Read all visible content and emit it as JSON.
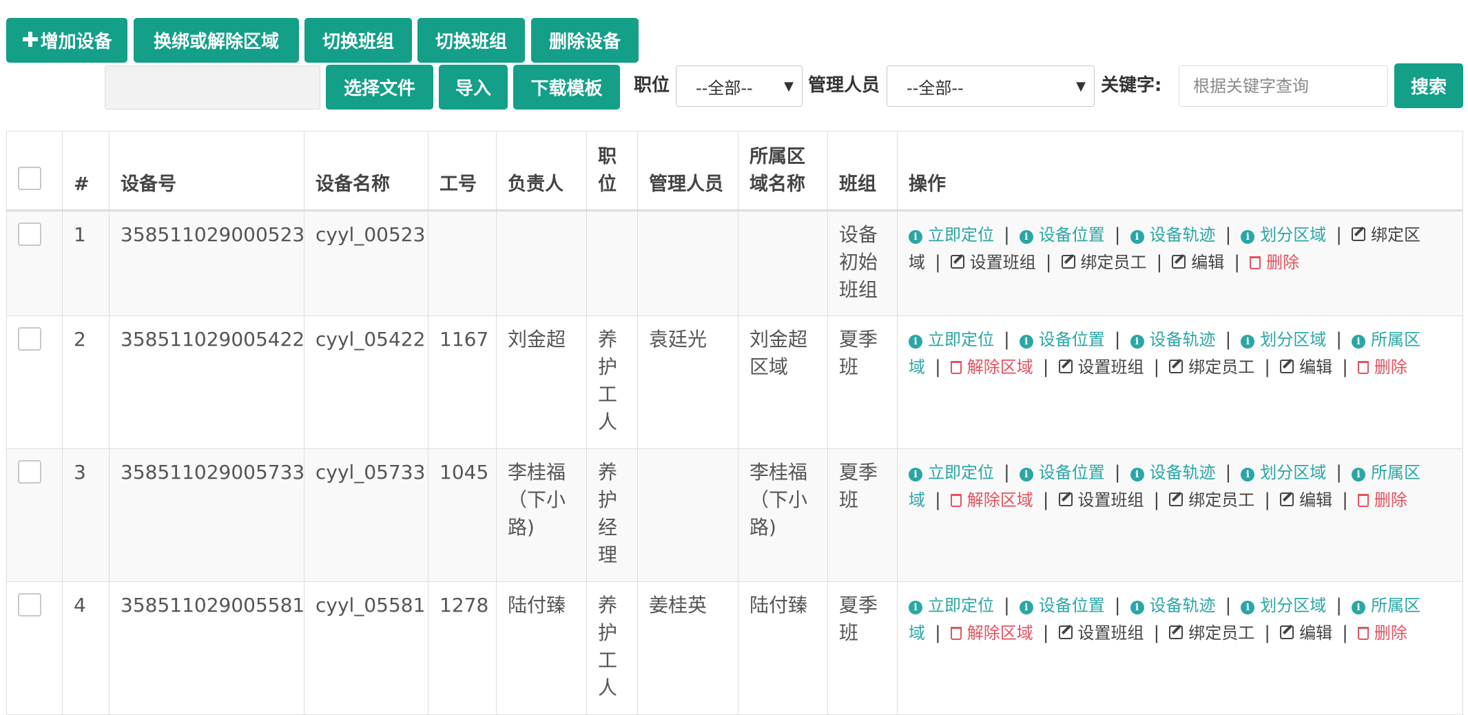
{
  "toolbar": {
    "add_device": "增加设备",
    "rebind_region": "换绑或解除区域",
    "switch_group_1": "切换班组",
    "switch_group_2": "切换班组",
    "delete_device": "删除设备",
    "choose_file": "选择文件",
    "import": "导入",
    "download_template": "下载模板",
    "position_label": "职位",
    "position_value": "--全部--",
    "manager_label": "管理人员",
    "manager_value": "--全部--",
    "keyword_label": "关键字:",
    "keyword_placeholder": "根据关键字查询",
    "search": "搜索"
  },
  "table": {
    "headers": [
      "#",
      "设备号",
      "设备名称",
      "工号",
      "负责人",
      "职位",
      "管理人员",
      "所属区域名称",
      "班组",
      "操作"
    ],
    "rows": [
      {
        "no": "1",
        "device_id": "358511029000523",
        "name": "cyyl_00523",
        "emp_no": "",
        "owner": "",
        "position": "",
        "manager": "",
        "region": "",
        "group": "设备初始班组"
      },
      {
        "no": "2",
        "device_id": "358511029005422",
        "name": "cyyl_05422",
        "emp_no": "1167",
        "owner": "刘金超",
        "position": "养护工人",
        "manager": "袁廷光",
        "region": "刘金超区域",
        "group": "夏季班"
      },
      {
        "no": "3",
        "device_id": "358511029005733",
        "name": "cyyl_05733",
        "emp_no": "1045",
        "owner": "李桂福（下小路)",
        "position": "养护经理",
        "manager": "",
        "region": "李桂福（下小路)",
        "group": "夏季班"
      },
      {
        "no": "4",
        "device_id": "358511029005581",
        "name": "cyyl_05581",
        "emp_no": "1278",
        "owner": "陆付臻",
        "position": "养护工人",
        "manager": "姜桂英",
        "region": "陆付臻",
        "group": "夏季班"
      }
    ],
    "ops": {
      "locate": "立即定位",
      "position": "设备位置",
      "track": "设备轨迹",
      "divide": "划分区域",
      "bind_region": "绑定区域",
      "region_of": "所属区域",
      "unbind_region": "解除区域",
      "set_group": "设置班组",
      "bind_staff": "绑定员工",
      "edit": "编辑",
      "delete": "删除"
    }
  },
  "colors": {
    "primary": "#139f88",
    "link_teal": "#2ba6a6",
    "danger": "#e6505e"
  }
}
